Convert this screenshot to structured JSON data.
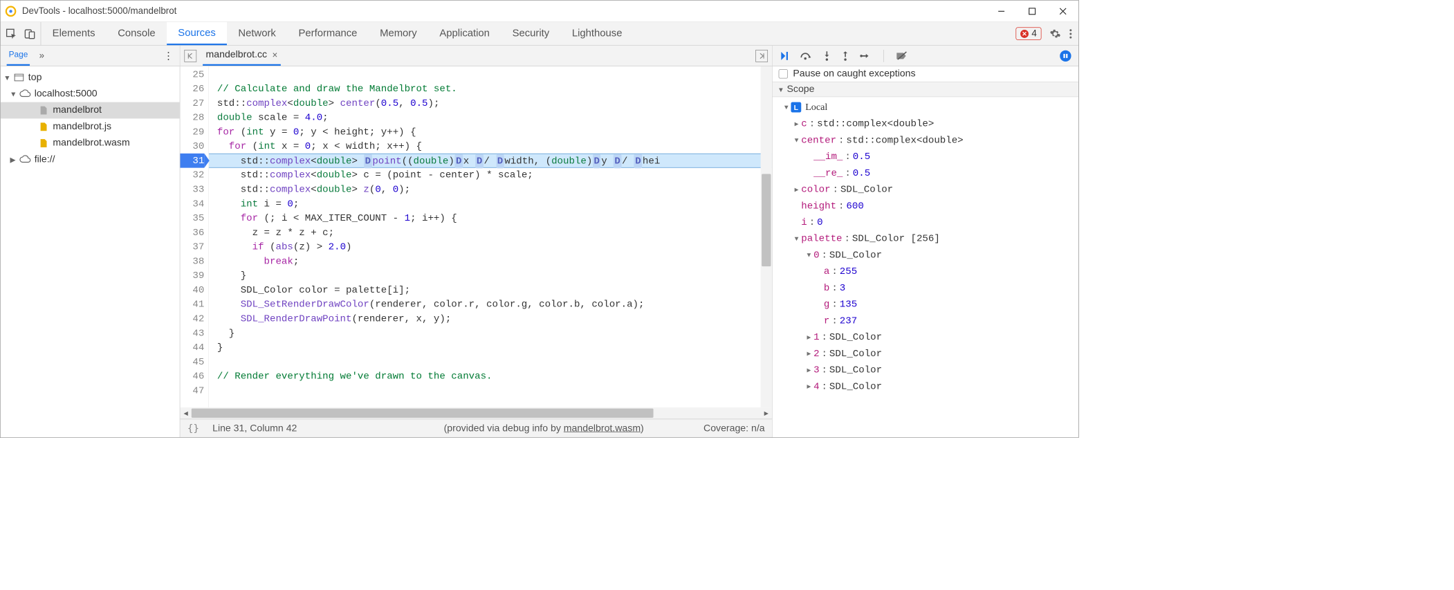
{
  "window": {
    "title": "DevTools - localhost:5000/mandelbrot"
  },
  "toolbar": {
    "tabs": [
      "Elements",
      "Console",
      "Sources",
      "Network",
      "Performance",
      "Memory",
      "Application",
      "Security",
      "Lighthouse"
    ],
    "active_tab": "Sources",
    "error_count": "4"
  },
  "sidebar": {
    "page_label": "Page",
    "tree": {
      "top": "top",
      "host": "localhost:5000",
      "files": [
        "mandelbrot",
        "mandelbrot.js",
        "mandelbrot.wasm"
      ],
      "file_scheme": "file://"
    }
  },
  "editor": {
    "filename": "mandelbrot.cc",
    "first_line_no": 25,
    "breakpoint_line": 31,
    "lines": [
      {
        "n": 25,
        "html": ""
      },
      {
        "n": 26,
        "html": "<span class='c-comment'>// Calculate and draw the Mandelbrot set.</span>"
      },
      {
        "n": 27,
        "html": "std::<span class='c-id'>complex</span>&lt;<span class='c-type'>double</span>&gt; <span class='c-id'>center</span>(<span class='c-num'>0.5</span>, <span class='c-num'>0.5</span>);"
      },
      {
        "n": 28,
        "html": "<span class='c-type'>double</span> scale = <span class='c-num'>4.0</span>;"
      },
      {
        "n": 29,
        "html": "<span class='c-key'>for</span> (<span class='c-type'>int</span> y = <span class='c-num'>0</span>; y &lt; height; y++) {"
      },
      {
        "n": 30,
        "html": "  <span class='c-key'>for</span> (<span class='c-type'>int</span> x = <span class='c-num'>0</span>; x &lt; width; x++) {"
      },
      {
        "n": 31,
        "html": "    std::<span class='c-id'>complex</span>&lt;<span class='c-type'>double</span>&gt; <span class='badge'>D</span><span class='c-id'>point</span>((<span class='c-type'>double</span>)<span class='badge'>D</span>x <span class='badge'>D</span>/ <span class='badge'>D</span>width, (<span class='c-type'>double</span>)<span class='badge'>D</span>y <span class='badge'>D</span>/ <span class='badge'>D</span>hei",
        "current": true
      },
      {
        "n": 32,
        "html": "    std::<span class='c-id'>complex</span>&lt;<span class='c-type'>double</span>&gt; c = (point - center) * scale;"
      },
      {
        "n": 33,
        "html": "    std::<span class='c-id'>complex</span>&lt;<span class='c-type'>double</span>&gt; <span class='c-id'>z</span>(<span class='c-num'>0</span>, <span class='c-num'>0</span>);"
      },
      {
        "n": 34,
        "html": "    <span class='c-type'>int</span> i = <span class='c-num'>0</span>;"
      },
      {
        "n": 35,
        "html": "    <span class='c-key'>for</span> (; i &lt; MAX_ITER_COUNT - <span class='c-num'>1</span>; i++) {"
      },
      {
        "n": 36,
        "html": "      z = z * z + c;"
      },
      {
        "n": 37,
        "html": "      <span class='c-key'>if</span> (<span class='c-id'>abs</span>(z) &gt; <span class='c-num'>2.0</span>)"
      },
      {
        "n": 38,
        "html": "        <span class='c-key'>break</span>;"
      },
      {
        "n": 39,
        "html": "    }"
      },
      {
        "n": 40,
        "html": "    SDL_Color color = palette[i];"
      },
      {
        "n": 41,
        "html": "    <span class='c-id'>SDL_SetRenderDrawColor</span>(renderer, color.r, color.g, color.b, color.a);"
      },
      {
        "n": 42,
        "html": "    <span class='c-id'>SDL_RenderDrawPoint</span>(renderer, x, y);"
      },
      {
        "n": 43,
        "html": "  }"
      },
      {
        "n": 44,
        "html": "}"
      },
      {
        "n": 45,
        "html": ""
      },
      {
        "n": 46,
        "html": "<span class='c-comment'>// Render everything we've drawn to the canvas.</span>"
      },
      {
        "n": 47,
        "html": ""
      }
    ]
  },
  "status": {
    "cursor": "Line 31, Column 42",
    "provided_prefix": "(provided via debug info by ",
    "provided_link": "mandelbrot.wasm",
    "provided_suffix": ")",
    "coverage": "Coverage: n/a"
  },
  "debug": {
    "pause_checkbox_label": "Pause on caught exceptions",
    "scope_label": "Scope",
    "local_label": "Local",
    "vars": {
      "c": "std::complex<double>",
      "center": "std::complex<double>",
      "center_im": {
        "k": "__im_",
        "v": "0.5"
      },
      "center_re": {
        "k": "__re_",
        "v": "0.5"
      },
      "color": "SDL_Color",
      "height": {
        "k": "height",
        "v": "600"
      },
      "i": {
        "k": "i",
        "v": "0"
      },
      "palette": "SDL_Color [256]",
      "p0": "SDL_Color",
      "p0_a": {
        "k": "a",
        "v": "255"
      },
      "p0_b": {
        "k": "b",
        "v": "3"
      },
      "p0_g": {
        "k": "g",
        "v": "135"
      },
      "p0_r": {
        "k": "r",
        "v": "237"
      },
      "p1": "SDL_Color",
      "p2": "SDL_Color",
      "p3": "SDL_Color",
      "p4": "SDL_Color"
    }
  }
}
